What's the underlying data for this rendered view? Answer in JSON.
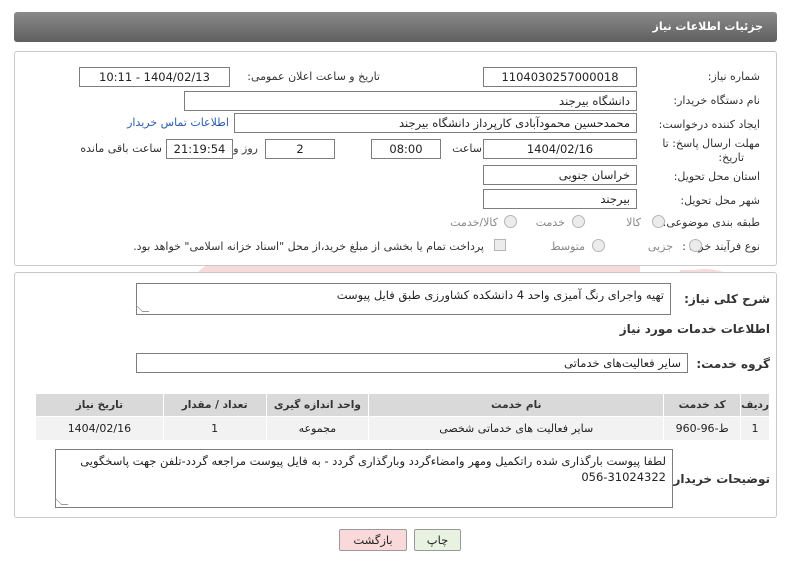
{
  "header": {
    "title": "جزئیات اطلاعات نیاز"
  },
  "need_number": {
    "label": "شماره نیاز:",
    "value": "1104030257000018"
  },
  "announce": {
    "label": "تاریخ و ساعت اعلان عمومی:",
    "value": "1404/02/13 - 10:11"
  },
  "buyer_org": {
    "label": "نام دستگاه خریدار:",
    "value": "دانشگاه بیرجند"
  },
  "requester": {
    "label": "ایجاد کننده درخواست:",
    "value": "محمدحسین محمودآبادی کارپرداز دانشگاه بیرجند",
    "contact_link": "اطلاعات تماس خریدار"
  },
  "deadline": {
    "label_line1": "مهلت ارسال پاسخ: تا",
    "label_line2": "تاریخ:",
    "date": "1404/02/16",
    "time_label": "ساعت",
    "time": "08:00",
    "days": "2",
    "days_label": "روز و",
    "remaining": "21:19:54",
    "remaining_label": "ساعت باقی مانده"
  },
  "province": {
    "label": "استان محل تحویل:",
    "value": "خراسان جنوبی"
  },
  "city": {
    "label": "شهر محل تحویل:",
    "value": "بیرجند"
  },
  "category": {
    "label": "طبقه بندی موضوعی:",
    "options": [
      "کالا",
      "خدمت",
      "کالا/خدمت"
    ]
  },
  "process": {
    "label": "نوع فرآیند خرید :",
    "options": [
      "جزیی",
      "متوسط"
    ],
    "payment_note": "پرداخت تمام یا بخشی از مبلغ خرید،از محل \"اسناد خزانه اسلامی\" خواهد بود."
  },
  "description": {
    "label": "شرح کلی نیاز:",
    "value": "تهیه واجرای رنگ آمیزی واحد 4 دانشکده کشاورزی طبق فایل پیوست"
  },
  "services_title": "اطلاعات خدمات مورد نیاز",
  "service_group": {
    "label": "گروه خدمت:",
    "value": "سایر فعالیت‌های خدماتی"
  },
  "table": {
    "headers": [
      "ردیف",
      "کد خدمت",
      "نام خدمت",
      "واحد اندازه گیری",
      "تعداد / مقدار",
      "تاریخ نیاز"
    ],
    "rows": [
      [
        "1",
        "ط-96-960",
        "سایر فعالیت های خدماتی شخصی",
        "مجموعه",
        "1",
        "1404/02/16"
      ]
    ]
  },
  "buyer_notes": {
    "label": "توضیحات خریدار:",
    "line1": "لطفا پیوست بارگذاری شده راتکمیل ومهر وامضاءگردد وبارگذاری گردد - به فایل پیوست مراجعه گردد-تلفن جهت پاسخگویی",
    "line2": "056-31024322"
  },
  "buttons": {
    "print": "چاپ",
    "back": "بازگشت"
  },
  "colors": {
    "header": "#6e6e6e",
    "link": "#2a5db0",
    "back_button": "#f9d9d9",
    "print_button": "#e7f3e0"
  }
}
